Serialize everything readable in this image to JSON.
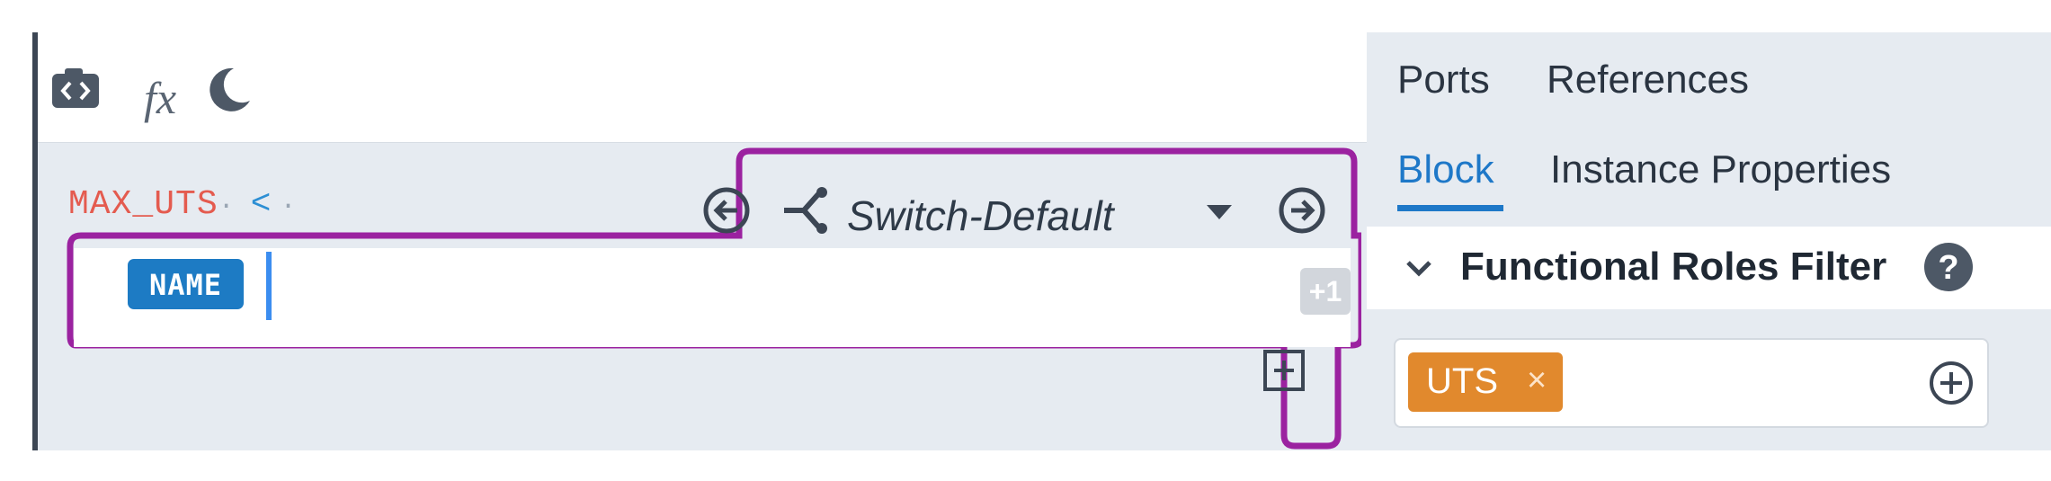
{
  "toolbar": {
    "fx_label": "fx",
    "icons": [
      "screenshot-code-icon",
      "function-icon",
      "moon-icon"
    ]
  },
  "expression": {
    "variable": "MAX_UTS",
    "operator": "<",
    "separator": "·",
    "tail": "·"
  },
  "switch": {
    "label": "Switch-Default",
    "prev_icon": "arrow-left-circle-icon",
    "next_icon": "arrow-right-circle-icon",
    "switch_icon": "switch-branch-icon"
  },
  "input": {
    "token": "NAME",
    "more_badge": "+1"
  },
  "right_panel": {
    "tabs_top": [
      "Ports",
      "References"
    ],
    "tabs_bottom": [
      "Block",
      "Instance Properties"
    ],
    "active_tab": "Block",
    "section_title": "Functional Roles Filter",
    "help": "?",
    "tags": [
      {
        "label": "UTS",
        "remove": "×"
      }
    ]
  },
  "colors": {
    "accent_blue": "#1e78c8",
    "variable_red": "#e45b4f",
    "tag_orange": "#e1892d",
    "outline_purple": "#9b22a0"
  }
}
